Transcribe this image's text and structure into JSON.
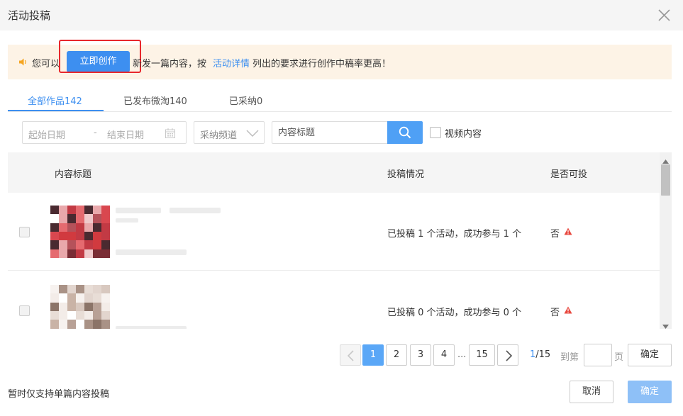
{
  "dialog": {
    "title": "活动投稿"
  },
  "notice": {
    "prefix": "您可以",
    "create_button": "立即创作",
    "middle": "新发一篇内容，按",
    "link": "活动详情",
    "suffix": "列出的要求进行创作中稿率更高！",
    "accent_color": "#3d8ff0"
  },
  "tabs": [
    {
      "label": "全部作品142",
      "active": true
    },
    {
      "label": "已发布微淘140",
      "active": false
    },
    {
      "label": "已采纳0",
      "active": false
    }
  ],
  "filters": {
    "start_date_placeholder": "起始日期",
    "separator": "-",
    "end_date_placeholder": "结束日期",
    "channel_placeholder": "采纳频道",
    "title_placeholder": "内容标题",
    "video_label": "视频内容"
  },
  "table": {
    "headers": {
      "title": "内容标题",
      "status": "投稿情况",
      "eligible": "是否可投"
    },
    "rows": [
      {
        "status": "已投稿 1 个活动，成功参与 1 个",
        "eligible": "否",
        "warning_icon": "warning-icon"
      },
      {
        "status": "已投稿 0 个活动，成功参与 0 个",
        "eligible": "否",
        "warning_icon": "warning-icon"
      }
    ]
  },
  "pagination": {
    "pages": [
      "1",
      "2",
      "3",
      "4",
      "15"
    ],
    "ellipsis": "...",
    "current": "1",
    "total": "/15",
    "goto_label": "到第",
    "page_label": "页",
    "confirm": "确定"
  },
  "footer": {
    "note": "暂时仅支持单篇内容投稿",
    "cancel": "取消",
    "ok": "确定"
  }
}
